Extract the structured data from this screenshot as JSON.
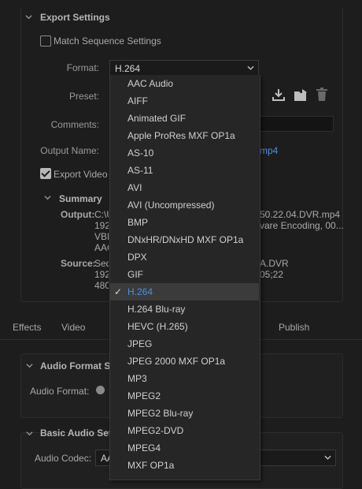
{
  "export_settings": {
    "title": "Export Settings",
    "match_sequence_label": "Match Sequence Settings",
    "format_label": "Format:",
    "format_value": "H.264",
    "preset_label": "Preset:",
    "comments_label": "Comments:",
    "output_name_label": "Output Name:",
    "output_name_value": "mp4",
    "export_video_label": "Export Video",
    "summary_title": "Summary",
    "output_label": "Output:",
    "output_lines": [
      "C:\\U",
      "192",
      "VBF",
      "AAC"
    ],
    "output_right_lines": [
      "50.22.04.DVR.mp4",
      "vare Encoding, 00..."
    ],
    "source_label": "Source:",
    "source_lines": [
      "Seq",
      "192",
      "480"
    ],
    "source_right_lines": [
      "A.DVR",
      "05;22"
    ]
  },
  "tabs": [
    "Effects",
    "Video",
    "Publish"
  ],
  "audio_format": {
    "title": "Audio Format Se",
    "label": "Audio Format:"
  },
  "basic_audio": {
    "title": "Basic Audio Setti",
    "codec_label": "Audio Codec:",
    "codec_value": "AA"
  },
  "format_menu": {
    "items": [
      "AAC Audio",
      "AIFF",
      "Animated GIF",
      "Apple ProRes MXF OP1a",
      "AS-10",
      "AS-11",
      "AVI",
      "AVI (Uncompressed)",
      "BMP",
      "DNxHR/DNxHD MXF OP1a",
      "DPX",
      "GIF",
      "H.264",
      "H.264 Blu-ray",
      "HEVC (H.265)",
      "JPEG",
      "JPEG 2000 MXF OP1a",
      "MP3",
      "MPEG2",
      "MPEG2 Blu-ray",
      "MPEG2-DVD",
      "MPEG4",
      "MXF OP1a"
    ],
    "selected": "H.264",
    "check_glyph": "✓"
  },
  "icons": [
    "chevron-down-icon",
    "import-preset-icon",
    "save-preset-icon",
    "delete-preset-icon"
  ]
}
